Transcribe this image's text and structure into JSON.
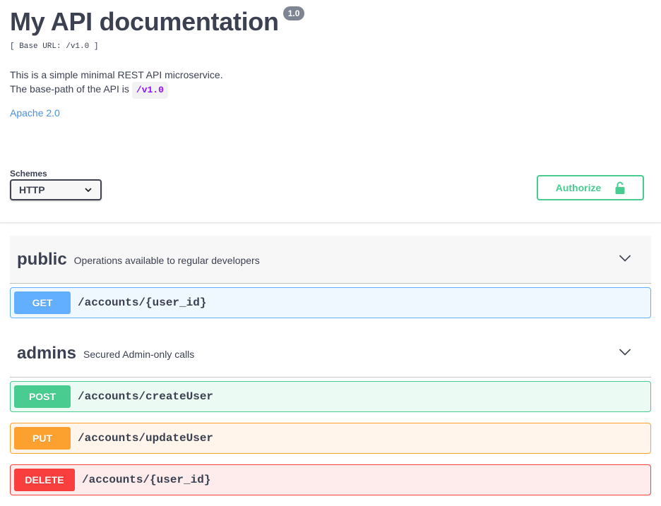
{
  "info": {
    "title": "My API documentation",
    "version": "1.0",
    "base_url": "[ Base URL: /v1.0 ]",
    "description_line1": "This is a simple minimal REST API microservice.",
    "description_line2": "The base-path of the API is",
    "base_path_code": "/v1.0",
    "license": "Apache 2.0"
  },
  "schemes": {
    "label": "Schemes",
    "selected": "HTTP"
  },
  "authorize": {
    "label": "Authorize",
    "icon": "unlocked-padlock-icon"
  },
  "tags": [
    {
      "name": "public",
      "description": "Operations available to regular developers",
      "operations": [
        {
          "method": "GET",
          "path": "/accounts/{user_id}"
        }
      ]
    },
    {
      "name": "admins",
      "description": "Secured Admin-only calls",
      "operations": [
        {
          "method": "POST",
          "path": "/accounts/createUser"
        },
        {
          "method": "PUT",
          "path": "/accounts/updateUser"
        },
        {
          "method": "DELETE",
          "path": "/accounts/{user_id}"
        }
      ]
    }
  ],
  "colors": {
    "get": "#61affe",
    "post": "#49cc90",
    "put": "#fca130",
    "delete": "#f93e3e",
    "text": "#3b4151",
    "link": "#4990e2",
    "code": "#9012fe"
  }
}
